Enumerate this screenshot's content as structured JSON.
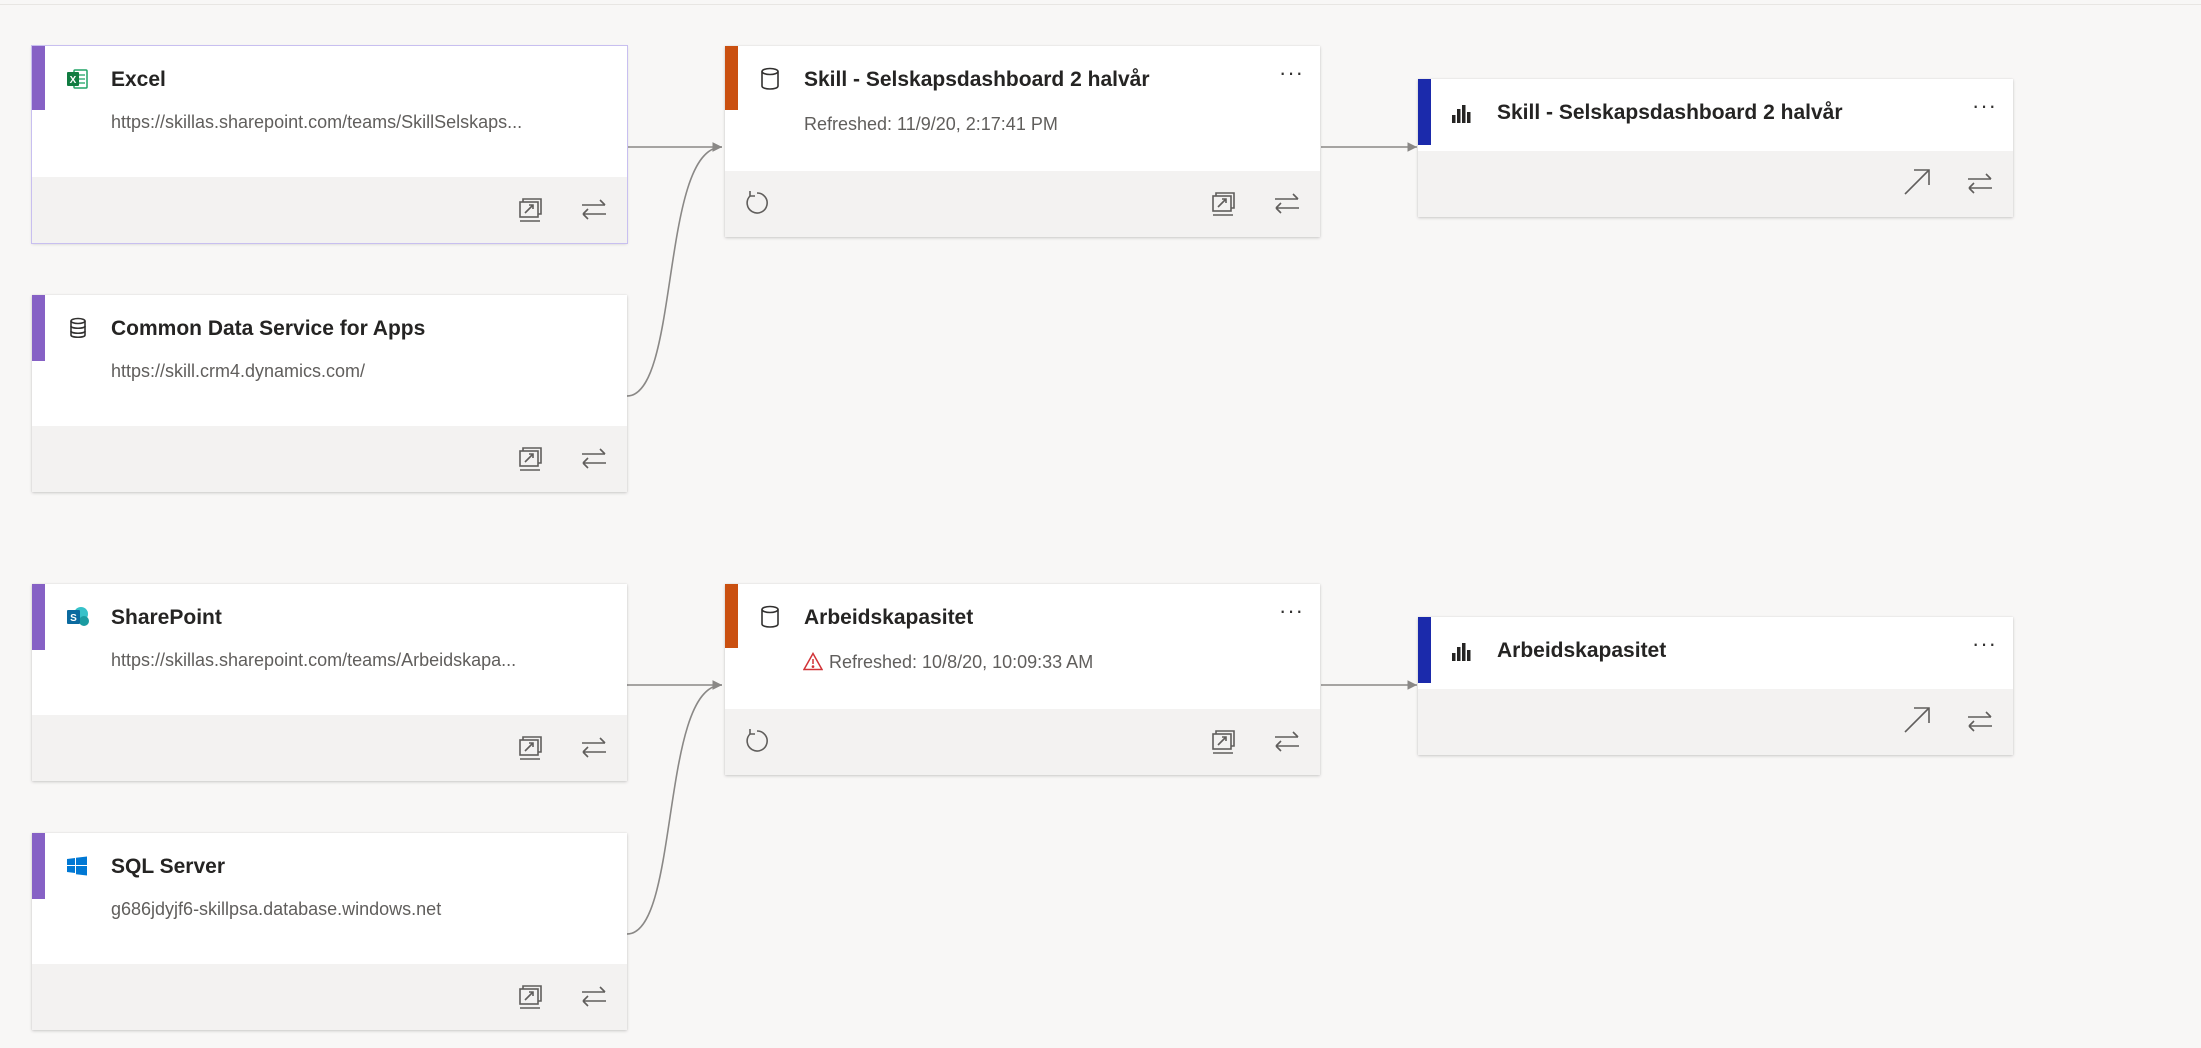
{
  "colors": {
    "source_accent": "#8661c5",
    "dataflow_accent": "#ca5010",
    "dataset_accent": "#1b2aab",
    "background": "#f8f7f6",
    "footer": "#f3f2f1",
    "warning": "#d13438"
  },
  "sources": [
    {
      "title": "Excel",
      "subtitle": "https://skillas.sharepoint.com/teams/SkillSelskaps...",
      "icon": "excel-icon"
    },
    {
      "title": "Common Data Service for Apps",
      "subtitle": "https://skill.crm4.dynamics.com/",
      "icon": "database-icon"
    },
    {
      "title": "SharePoint",
      "subtitle": "https://skillas.sharepoint.com/teams/Arbeidskapa...",
      "icon": "sharepoint-icon"
    },
    {
      "title": "SQL Server",
      "subtitle": "g686jdyjf6-skillpsa.database.windows.net",
      "icon": "sql-server-icon"
    }
  ],
  "dataflows": [
    {
      "title": "Skill - Selskapsdashboard 2 halvår",
      "status": "Refreshed: 11/9/20, 2:17:41 PM",
      "warning": false,
      "more": "···"
    },
    {
      "title": "Arbeidskapasitet",
      "status": "Refreshed: 10/8/20, 10:09:33 AM",
      "warning": true,
      "more": "···"
    }
  ],
  "datasets": [
    {
      "title": "Skill - Selskapsdashboard 2 halvår",
      "more": "···"
    },
    {
      "title": "Arbeidskapasitet",
      "more": "···"
    }
  ]
}
